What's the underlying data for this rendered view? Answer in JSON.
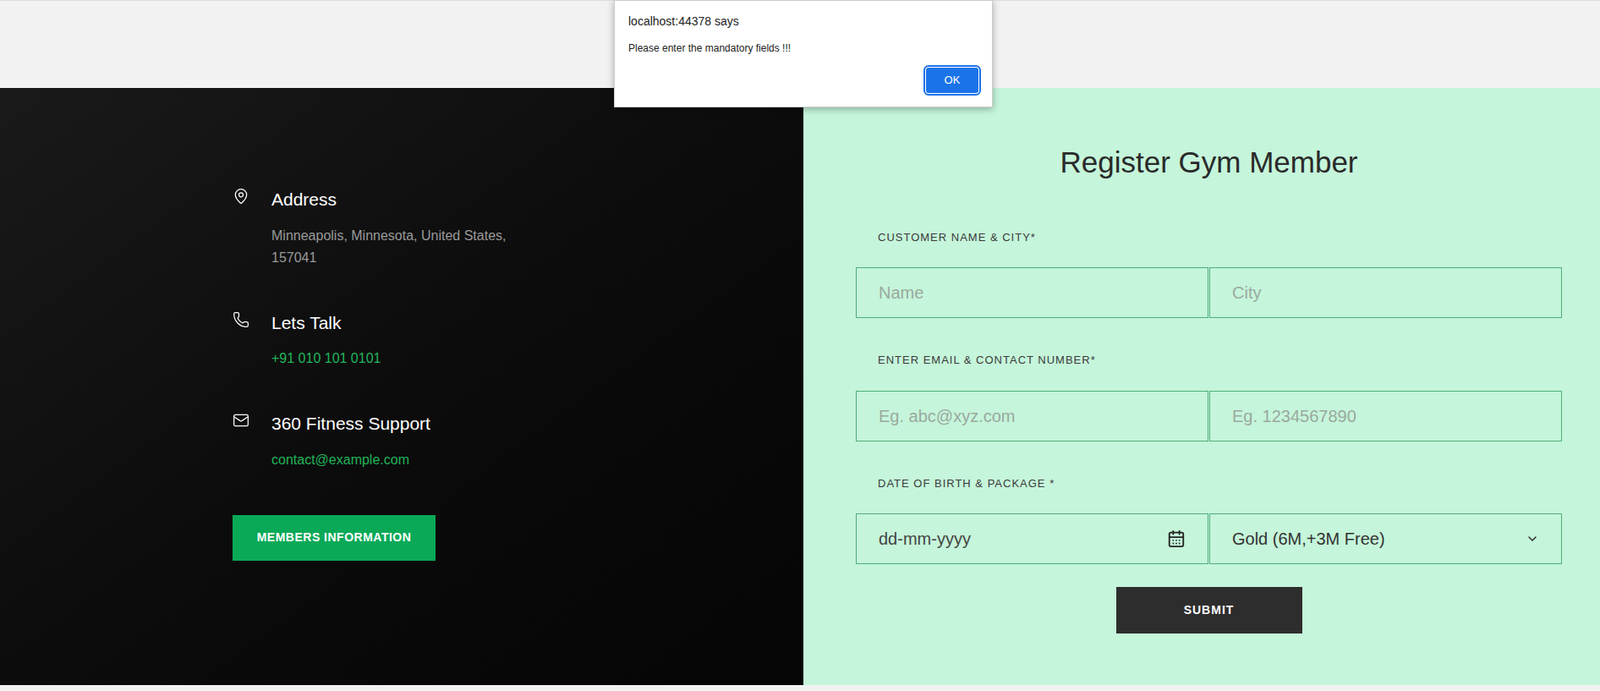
{
  "alert": {
    "origin": "localhost:44378 says",
    "message": "Please enter the mandatory fields !!!",
    "button": "OK"
  },
  "contact": [
    {
      "title": "Address",
      "detail": "Minneapolis, Minnesota, United States, 157041",
      "kind": "address"
    },
    {
      "title": "Lets Talk",
      "detail": "+91 010 101 0101",
      "kind": "phone"
    },
    {
      "title": "360 Fitness Support",
      "detail": "contact@example.com",
      "kind": "mail"
    }
  ],
  "members_button": "MEMBERS INFORMATION",
  "form": {
    "title": "Register Gym Member",
    "rows": [
      {
        "label": "CUSTOMER NAME & CITY*",
        "fields": [
          {
            "kind": "text",
            "placeholder": "Name"
          },
          {
            "kind": "text",
            "placeholder": "City"
          }
        ]
      },
      {
        "label": "ENTER EMAIL & CONTACT NUMBER*",
        "fields": [
          {
            "kind": "text",
            "placeholder": "Eg. abc@xyz.com"
          },
          {
            "kind": "text",
            "placeholder": "Eg. 1234567890"
          }
        ]
      },
      {
        "label": "DATE OF BIRTH & PACKAGE *",
        "fields": [
          {
            "kind": "date",
            "placeholder": "dd-mm-yyyy"
          },
          {
            "kind": "select",
            "placeholder": "Gold (6M,+3M Free)"
          }
        ]
      }
    ],
    "submit": "SUBMIT"
  }
}
